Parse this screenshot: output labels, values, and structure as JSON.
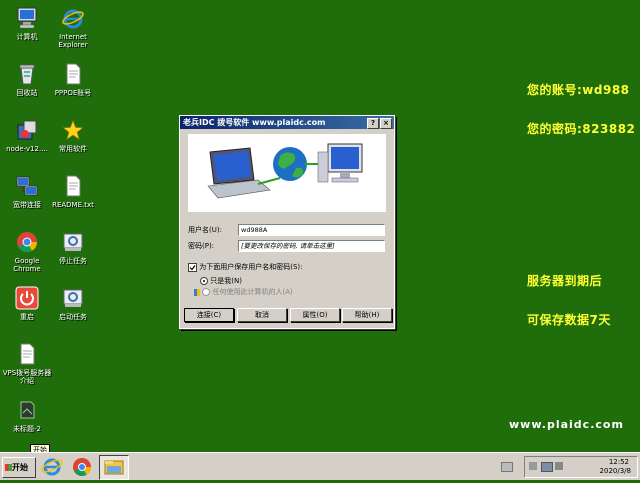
{
  "desktop": {
    "icons": [
      {
        "label": "计算机",
        "icon": "computer-icon"
      },
      {
        "label": "Internet Explorer",
        "icon": "ie-icon"
      },
      {
        "label": "回收站",
        "icon": "recycle-bin-icon"
      },
      {
        "label": "PPPOE账号",
        "icon": "text-file-icon"
      },
      {
        "label": "node-v12....",
        "icon": "installer-icon"
      },
      {
        "label": "常用软件",
        "icon": "star-icon"
      },
      {
        "label": "宽带连接",
        "icon": "network-icon"
      },
      {
        "label": "README.txt",
        "icon": "text-file-icon"
      },
      {
        "label": "Google Chrome",
        "icon": "chrome-icon"
      },
      {
        "label": "停止任务",
        "icon": "task-icon"
      },
      {
        "label": "重启",
        "icon": "power-icon"
      },
      {
        "label": "启动任务",
        "icon": "task-icon"
      },
      {
        "label": "VPS拨号服务器介绍",
        "icon": "text-file-icon"
      },
      {
        "label": "未标题-2",
        "icon": "image-file-icon"
      }
    ],
    "account_line": "您的账号:wd988",
    "password_line": "您的密码:823882",
    "expire_line": "服务器到期后",
    "keep_line": "可保存数据7天",
    "site_url": "www.plaidc.com"
  },
  "dialog": {
    "title": "老兵IDC 拨号软件   www.plaidc.com",
    "username_label": "用户名(U):",
    "username_value": "wd988A",
    "password_label": "密码(P):",
    "password_value": "[要更改保存的密码, 请单击这里]",
    "save_checkbox_label": "为下面用户保存用户名和密码(S):",
    "save_checked": true,
    "radio_me_label": "只是我(N)",
    "radio_anyone_label": "任何使用此计算机的人(A)",
    "buttons": {
      "connect": "连接(C)",
      "cancel": "取消",
      "properties": "属性(O)",
      "help": "帮助(H)"
    }
  },
  "taskbar": {
    "start_label": "开始",
    "tooltip": "开始",
    "clock_time": "12:52",
    "clock_date": "2020/3/8"
  },
  "colors": {
    "desktop": "#1f6d0b",
    "highlight_text": "#ffff33",
    "title_bar": "#0a246a"
  }
}
